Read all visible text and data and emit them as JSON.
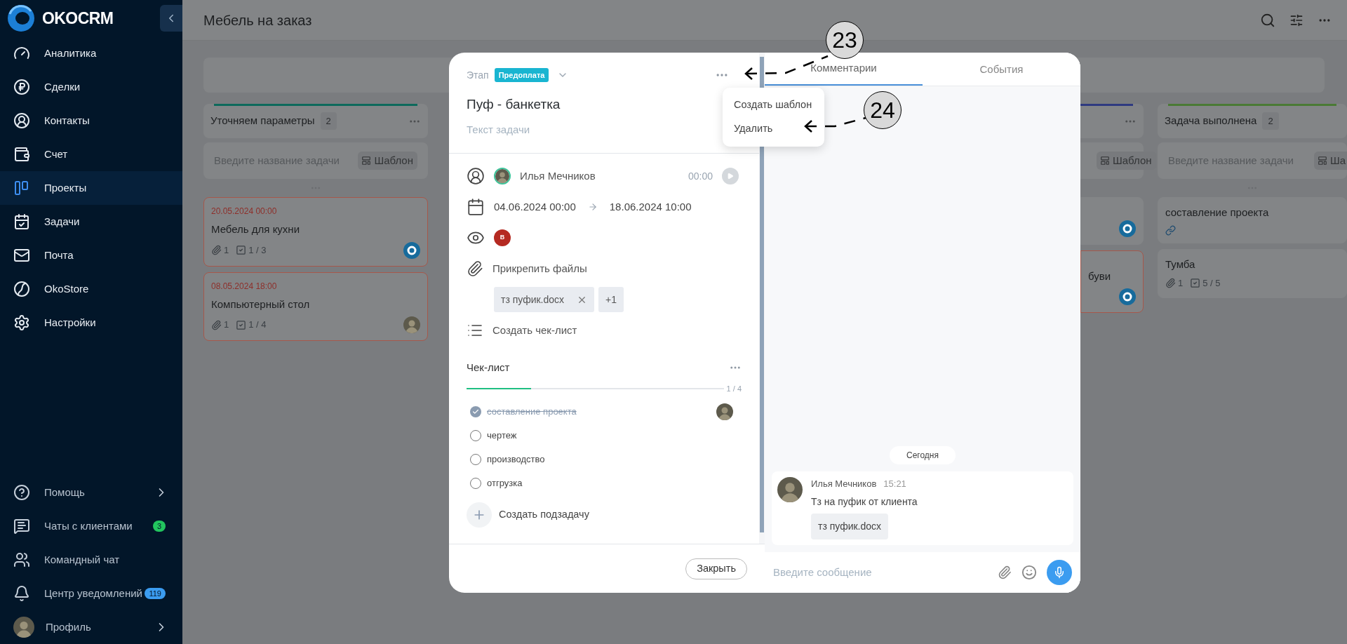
{
  "sidebar": {
    "logo": "OKOCRM",
    "items": [
      {
        "label": "Аналитика",
        "selected": false
      },
      {
        "label": "Сделки",
        "selected": false
      },
      {
        "label": "Контакты",
        "selected": false
      },
      {
        "label": "Счет",
        "selected": false
      },
      {
        "label": "Проекты",
        "selected": true
      },
      {
        "label": "Задачи",
        "selected": false
      },
      {
        "label": "Почта",
        "selected": false
      },
      {
        "label": "OkoStore",
        "selected": false
      },
      {
        "label": "Настройки",
        "selected": false
      }
    ],
    "bottom_items": [
      {
        "kind": "link",
        "label": "Помощь",
        "expandable": true
      },
      {
        "kind": "link",
        "label": "Чаты с клиентами",
        "expandable": false,
        "badge": {
          "text": "3",
          "color": "#22c55e"
        }
      },
      {
        "kind": "link",
        "label": "Командный чат",
        "expandable": false
      },
      {
        "kind": "link",
        "label": "Центр уведомлений",
        "expandable": false,
        "badge": {
          "text": "119",
          "color": "#3b9cf0"
        }
      },
      {
        "kind": "profile",
        "label": "Профиль",
        "expandable": true
      }
    ]
  },
  "header": {
    "title": "Мебель на заказ"
  },
  "board": {
    "columns": [
      {
        "title": "Уточняем параметры",
        "count": "2",
        "color": "#0e6a5c",
        "input_placeholder": "Введите название задачи",
        "template_button": "Шаблон",
        "cards": [
          {
            "date": "20.05.2024 00:00",
            "title": "Мебель для кухни",
            "attachments": "1",
            "checklist": "1 / 3",
            "overdue": true,
            "assignee": {
              "kind": "bot"
            }
          },
          {
            "date": "08.05.2024 18:00",
            "title": "Компьютерный стол",
            "attachments": "1",
            "checklist": "1 / 4",
            "overdue": true,
            "assignee": {
              "kind": "photo"
            }
          }
        ]
      },
      {
        "title": "Задача выполнена",
        "count": "2",
        "color": "#4a7a35",
        "input_placeholder": "Введите название задачи",
        "template_button": "Ша",
        "cards": [
          {
            "title": "составление проекта",
            "link": true,
            "overdue": false
          },
          {
            "title": "Тумба",
            "attachments": "1",
            "checklist": "5 / 5",
            "overdue": false
          }
        ]
      }
    ],
    "partial_column": {
      "color": "#2f3a80",
      "template_button": "Шаблон",
      "cards": [
        {
          "overdue": false,
          "assignee": {
            "kind": "bot"
          }
        },
        {
          "title": "буви",
          "overdue": true,
          "assignee": {
            "kind": "bot"
          }
        }
      ]
    }
  },
  "task": {
    "stage_label": "Этап",
    "stage": "Предоплата",
    "title": "Пуф - банкетка",
    "description_placeholder": "Текст задачи",
    "assignee": "Илья Мечников",
    "timer": "00:00",
    "start": "04.06.2024 00:00",
    "end": "18.06.2024 10:00",
    "watcher_initial": "В",
    "attach_label": "Прикрепить файлы",
    "files": [
      {
        "name": "тз пуфик.docx"
      }
    ],
    "more_files": "+1",
    "create_checklist": "Создать чек-лист",
    "checklist": {
      "title": "Чек-лист",
      "level": 0.25,
      "progress": "1 / 4",
      "items": [
        {
          "text": "составление проекта",
          "checked": true,
          "has_assignee": true
        },
        {
          "text": "чертеж",
          "checked": false,
          "has_assignee": false
        },
        {
          "text": "производство",
          "checked": false,
          "has_assignee": false
        },
        {
          "text": "отгрузка",
          "checked": false,
          "has_assignee": false
        }
      ]
    },
    "create_subtask": "Создать подзадачу",
    "close_button": "Закрыть"
  },
  "menu": {
    "items": [
      "Создать шаблон",
      "Удалить"
    ]
  },
  "comments_panel": {
    "tabs": [
      {
        "label": "Комментарии",
        "selected": true
      },
      {
        "label": "События",
        "selected": false
      }
    ],
    "date_divider": "Сегодня",
    "messages": [
      {
        "author": "Илья Мечников",
        "time": "15:21",
        "text": "Тз на пуфик от клиента",
        "attachment": "тз пуфик.docx"
      }
    ],
    "input_placeholder": "Введите сообщение"
  },
  "callouts": [
    {
      "number": "23"
    },
    {
      "number": "24"
    }
  ]
}
